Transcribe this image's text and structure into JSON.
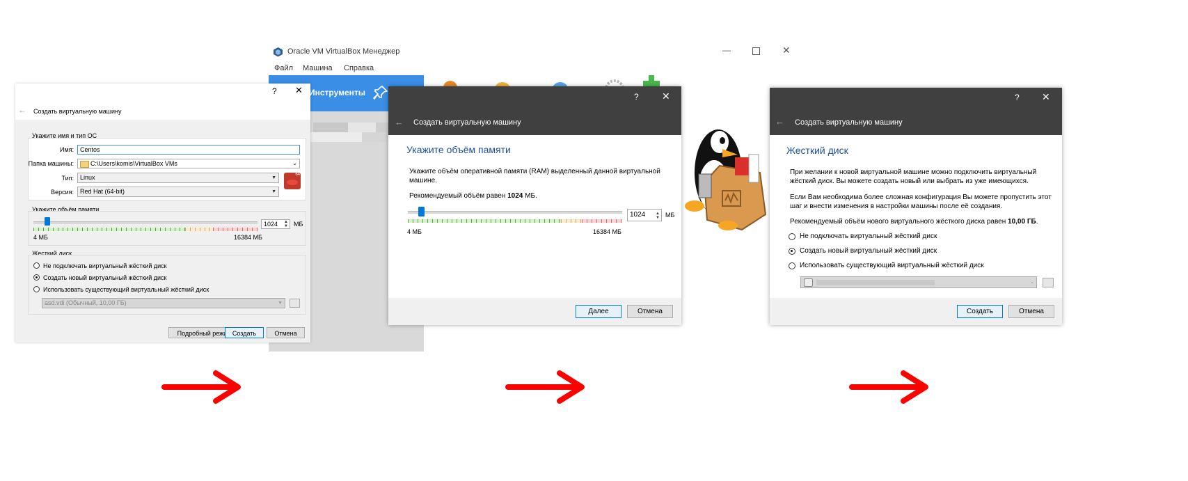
{
  "manager": {
    "title": "Oracle VM VirtualBox Менеджер",
    "menu": [
      "Файл",
      "Машина",
      "Справка"
    ],
    "tools_label": "Инструменты"
  },
  "dialog1": {
    "help": "?",
    "close": "✕",
    "back": "←",
    "title": "Создать виртуальную машину",
    "os_group": "Укажите имя и тип ОС",
    "name_label": "Имя:",
    "name_value": "Centos",
    "folder_label": "Папка машины:",
    "folder_value": "C:\\Users\\komis\\VirtualBox VMs",
    "type_label": "Тип:",
    "type_value": "Linux",
    "version_label": "Версия:",
    "version_value": "Red Hat (64-bit)",
    "os_badge": "64",
    "memory_group": "Укажите объём памяти",
    "memory_value": "1024",
    "memory_unit": "МБ",
    "memory_min": "4 МБ",
    "memory_max": "16384 МБ",
    "memory_fraction": 0.062,
    "disk_group": "Жесткий диск",
    "disk_options": [
      "Не подключать виртуальный жёсткий диск",
      "Создать новый виртуальный жёсткий диск",
      "Использовать существующий виртуальный жёсткий диск"
    ],
    "disk_selected": 1,
    "existing_disk": "asd.vdi (Обычный, 10,00 ГБ)",
    "btn_expert": "Подробный режим",
    "btn_create": "Создать",
    "btn_cancel": "Отмена"
  },
  "dialog2": {
    "help": "?",
    "close": "✕",
    "back": "←",
    "title": "Создать виртуальную машину",
    "step_title": "Укажите объём памяти",
    "description": "Укажите объём оперативной памяти (RAM) выделенный данной виртуальной машине.",
    "recommended_prefix": "Рекомендуемый объём равен ",
    "recommended_value": "1024",
    "recommended_suffix": " МБ.",
    "memory_value": "1024",
    "memory_unit": "МБ",
    "memory_min": "4 МБ",
    "memory_max": "16384 МБ",
    "memory_fraction": 0.062,
    "btn_next": "Далее",
    "btn_cancel": "Отмена"
  },
  "dialog3": {
    "help": "?",
    "close": "✕",
    "back": "←",
    "title": "Создать виртуальную машину",
    "step_title": "Жесткий диск",
    "para1": "При желании к новой виртуальной машине можно подключить виртуальный жёсткий диск. Вы можете создать новый или выбрать из уже имеющихся.",
    "para2": "Если Вам необходима более сложная конфигурация Вы можете пропустить этот шаг и внести изменения в настройки машины после её создания.",
    "recommended_prefix": "Рекомендуемый объём нового виртуального жёсткого диска равен ",
    "recommended_value": "10,00 ГБ",
    "recommended_suffix": ".",
    "disk_options": [
      "Не подключать виртуальный жёсткий диск",
      "Создать новый виртуальный жёсткий диск",
      "Использовать существующий виртуальный жёсткий диск"
    ],
    "disk_selected": 1,
    "btn_create": "Создать",
    "btn_cancel": "Отмена"
  },
  "colors": {
    "arrow": "#ff0000",
    "tools_blue": "#3a8ee6",
    "dialog_header": "#404040",
    "title_blue": "#1c4e9b"
  },
  "icons": [
    "virtualbox-logo-icon",
    "wrench-icon",
    "pin-icon",
    "list-icon",
    "penguin-toolbox-illustration",
    "folder-icon",
    "redhat-icon",
    "hard-disk-icon",
    "right-arrow-icon"
  ]
}
